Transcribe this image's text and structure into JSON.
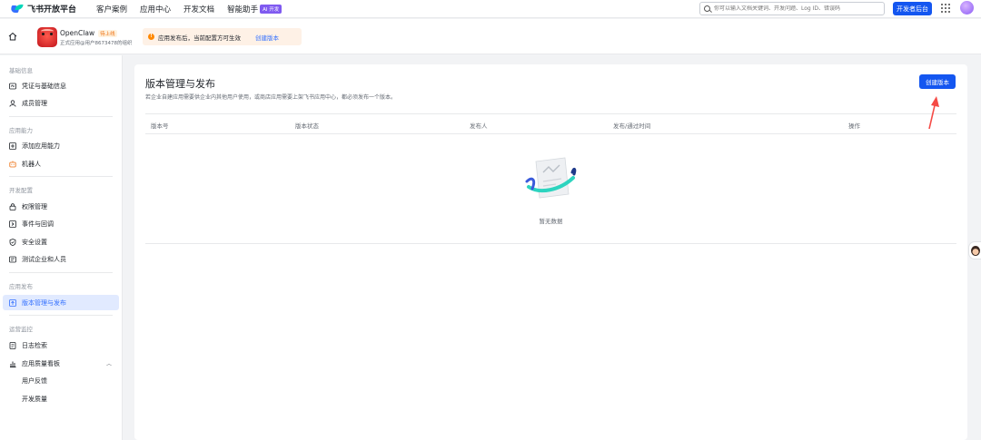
{
  "topnav": {
    "brand": "飞书开放平台",
    "links": [
      "客户案例",
      "应用中心",
      "开发文档",
      "智能助手"
    ],
    "ai_badge": "AI 开发",
    "search_placeholder": "你可以输入文档关键词、开发问题、Log ID、错误码",
    "dev_console": "开发者后台"
  },
  "appbar": {
    "app_name": "OpenClaw",
    "app_status": "待上线",
    "app_sub": "正式应用@用户8673478的组织",
    "notice": "应用发布后，当前配置方可生效",
    "notice_link": "创建版本"
  },
  "sidebar": {
    "sections": [
      {
        "title": "基础信息",
        "items": [
          "凭证与基础信息",
          "成员管理"
        ]
      },
      {
        "title": "应用能力",
        "items": [
          "添加应用能力",
          "机器人"
        ]
      },
      {
        "title": "开发配置",
        "items": [
          "权限管理",
          "事件与回调",
          "安全设置",
          "测试企业和人员"
        ]
      },
      {
        "title": "应用发布",
        "items": [
          "版本管理与发布"
        ]
      },
      {
        "title": "运营监控",
        "items": [
          "日志检索",
          "应用质量看板"
        ],
        "subitems": [
          "用户反馈",
          "开发质量"
        ]
      }
    ]
  },
  "main": {
    "title": "版本管理与发布",
    "description": "若企业自建应用需要供企业内其他用户使用，或商店应用需要上架飞书应用中心，都必须发布一个版本。",
    "create_button": "创建版本",
    "columns": [
      "版本号",
      "版本状态",
      "发布人",
      "发布/通过时间",
      "操作"
    ],
    "empty_text": "暂无数据"
  },
  "colors": {
    "primary": "#1456f0",
    "link": "#3370ff",
    "active_bg": "#e1eaff",
    "warning": "#ff8800",
    "arrow": "#f54a45"
  }
}
